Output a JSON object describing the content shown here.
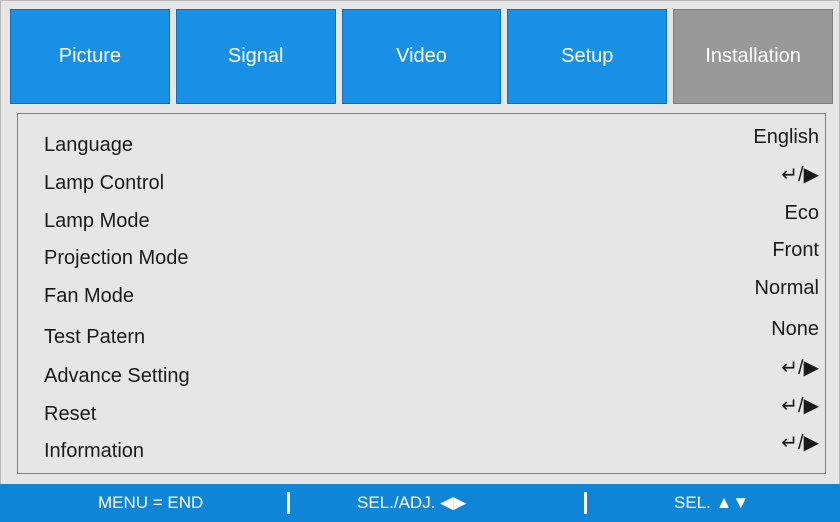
{
  "tabs": [
    {
      "label": "Picture"
    },
    {
      "label": "Signal"
    },
    {
      "label": "Video"
    },
    {
      "label": "Setup"
    },
    {
      "label": "Installation"
    }
  ],
  "active_tab": "Installation",
  "menu": [
    {
      "label": "Language",
      "value": "English"
    },
    {
      "label": "Lamp Control",
      "value": "↵/▶"
    },
    {
      "label": "Lamp Mode",
      "value": "Eco"
    },
    {
      "label": "Projection Mode",
      "value": "Front"
    },
    {
      "label": "Fan Mode",
      "value": "Normal"
    },
    {
      "label": "Test Patern",
      "value": "None"
    },
    {
      "label": "Advance Setting",
      "value": "↵/▶"
    },
    {
      "label": "Reset",
      "value": "↵/▶"
    },
    {
      "label": "Information",
      "value": "↵/▶"
    }
  ],
  "statusbar": {
    "menu_end": "MENU = END",
    "sel_adj": "SEL./ADJ. ◀▶",
    "sel": "SEL. ▲▼"
  },
  "colors": {
    "tab_blue": "#1790e6",
    "tab_active_gray": "#999999",
    "panel_border_green": "#49a06a",
    "statusbar_blue": "#0f85d8"
  }
}
